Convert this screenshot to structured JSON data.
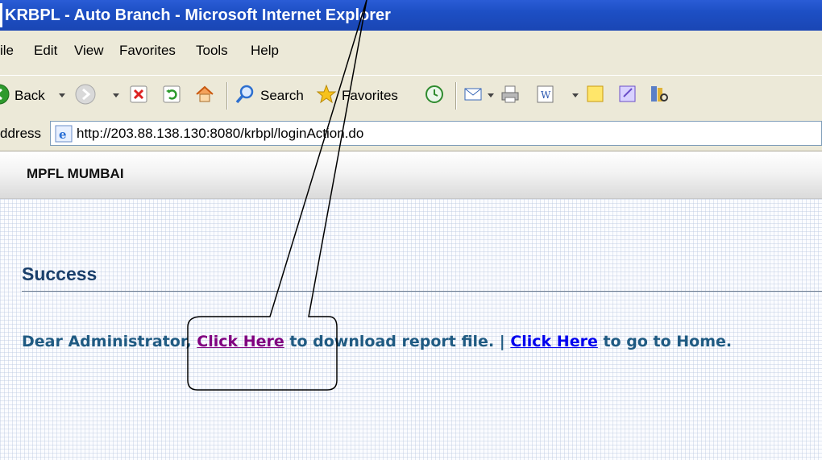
{
  "window": {
    "title": "KRBPL - Auto Branch - Microsoft Internet Explorer"
  },
  "menu": [
    "ile",
    "Edit",
    "View",
    "Favorites",
    "Tools",
    "Help"
  ],
  "toolbar": {
    "back_label": "Back",
    "search_label": "Search",
    "favorites_label": "Favorites"
  },
  "address": {
    "label": "ddress",
    "url": "http://203.88.138.130:8080/krbpl/loginAction.do"
  },
  "app": {
    "header_title": "MPFL MUMBAI"
  },
  "content": {
    "heading": "Success",
    "greeting": "Dear Administrator, ",
    "link1": "Click Here",
    "text_mid": " to download report file. | ",
    "link2": "Click Here",
    "text_end": " to go to Home."
  },
  "colors": {
    "titlebar": "#1d4fc4",
    "chrome": "#ece9d8",
    "heading": "#1a3f6b",
    "message": "#1f5a82",
    "visited_link": "#800080",
    "link": "#0000ee"
  },
  "icons": [
    "back-icon",
    "forward-icon",
    "stop-icon",
    "refresh-icon",
    "home-icon",
    "search-icon",
    "favorites-icon",
    "history-icon",
    "mail-icon",
    "print-icon",
    "edit-icon",
    "discuss-icon",
    "messenger-icon",
    "research-icon",
    "ie-page-icon"
  ]
}
